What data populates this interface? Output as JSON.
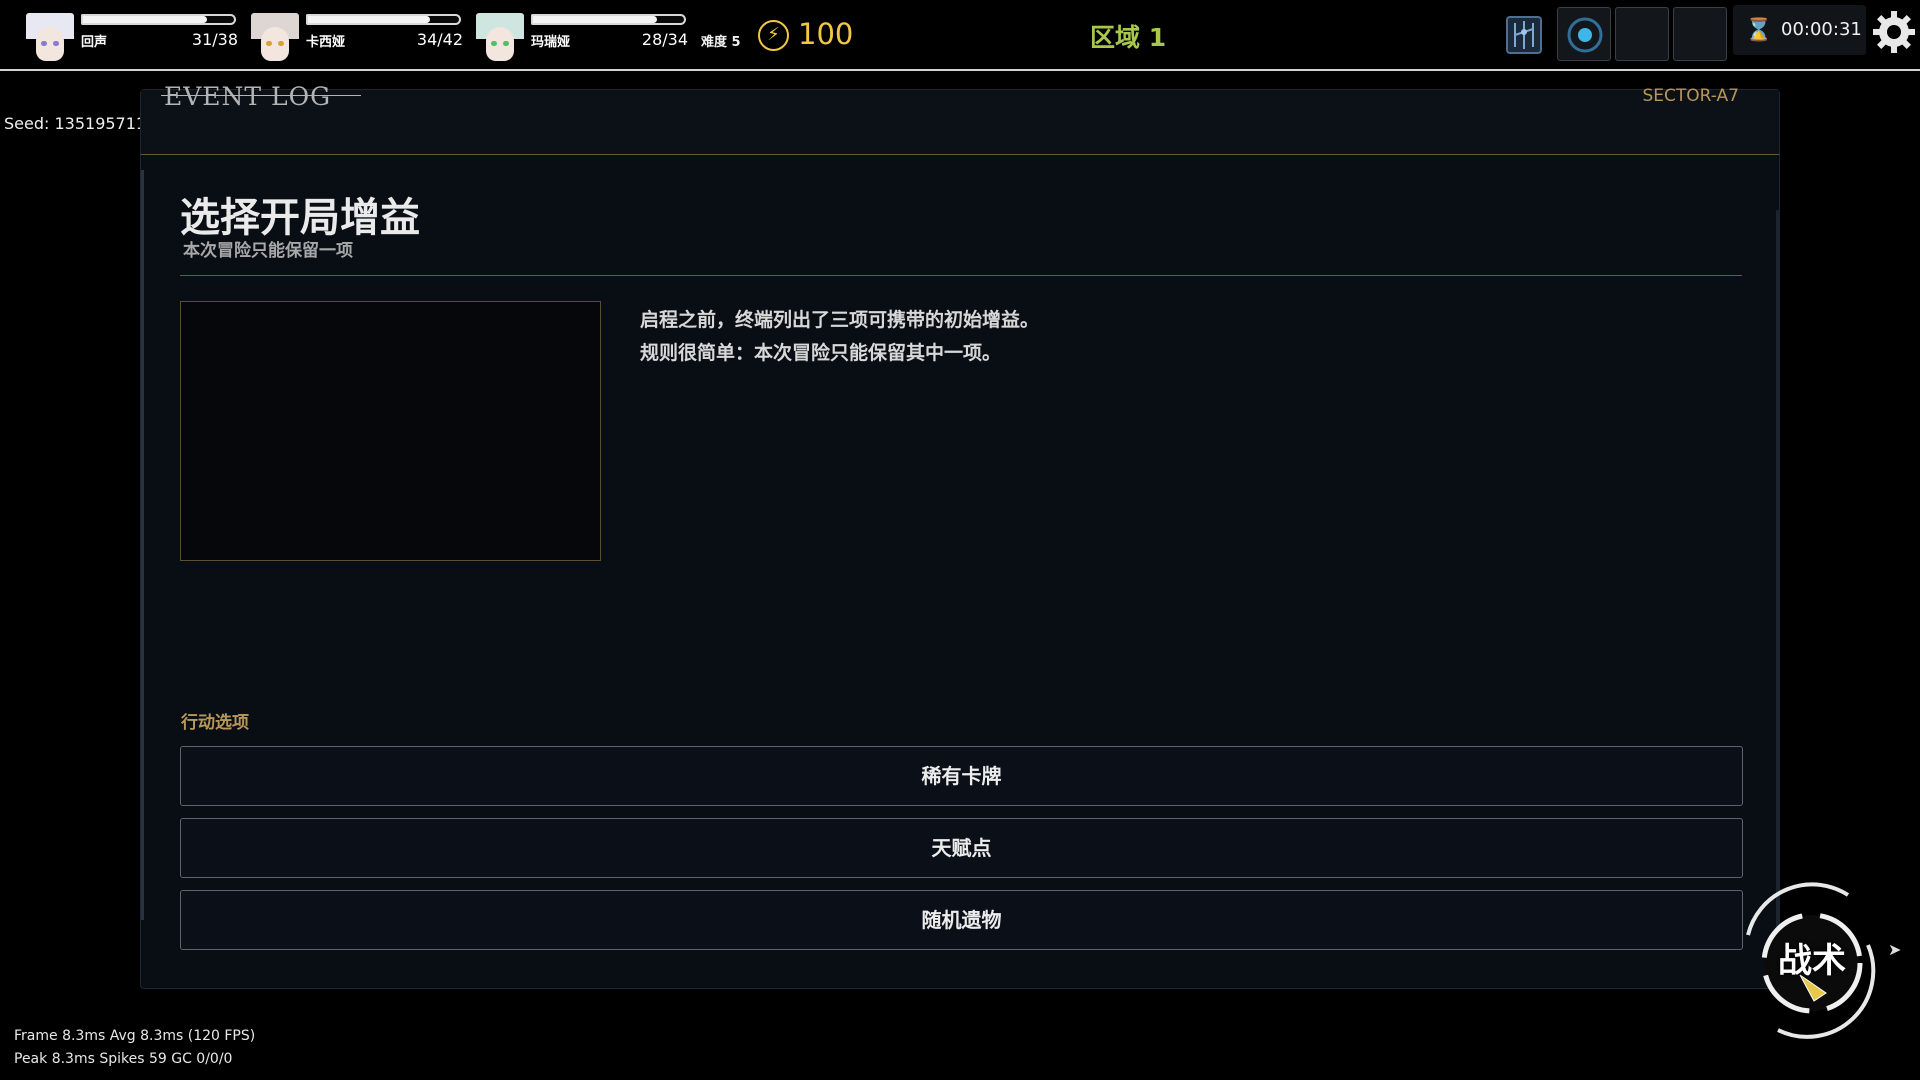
{
  "party": [
    {
      "name": "回声",
      "hp": "31/38",
      "hp_fraction": 0.82,
      "hair_color": "#e8e8f2",
      "eye_color": "#8a7ad0"
    },
    {
      "name": "卡西娅",
      "hp": "34/42",
      "hp_fraction": 0.81,
      "hair_color": "#ddd6d2",
      "eye_color": "#d9a13a"
    },
    {
      "name": "玛瑞娅",
      "hp": "28/34",
      "hp_fraction": 0.82,
      "hair_color": "#cfe6e0",
      "eye_color": "#4fbf6a"
    }
  ],
  "hud": {
    "difficulty": "难度 5",
    "energy_icon": "lightning-icon",
    "energy": "100",
    "zone": "区域 1",
    "timer": "00:00:31",
    "icons": [
      "map-icon",
      "skill-slot-icon",
      "settings-icon",
      "hourglass-icon"
    ]
  },
  "seed": "Seed: 135195711",
  "panel": {
    "header_title": "EVENT LOG",
    "sector": "SECTOR-A7",
    "event_title": "选择开局增益",
    "event_subtitle": "本次冒险只能保留一项",
    "event_text_line1": "启程之前，终端列出了三项可携带的初始增益。",
    "event_text_line2": "规则很简单：本次冒险只能保留其中一项。",
    "actions_label": "行动选项",
    "choices": [
      "稀有卡牌",
      "天赋点",
      "随机遗物"
    ]
  },
  "tactics_label": "战术",
  "perf": {
    "line1": "Frame 8.3ms  Avg 8.3ms (120 FPS)",
    "line2": "Peak 8.3ms  Spikes 59  GC 0/0/0"
  },
  "colors": {
    "accent_gold": "#b8975a",
    "energy_yellow": "#f2c744",
    "zone_green": "#a7c84a",
    "panel_bg": "#090d14"
  }
}
